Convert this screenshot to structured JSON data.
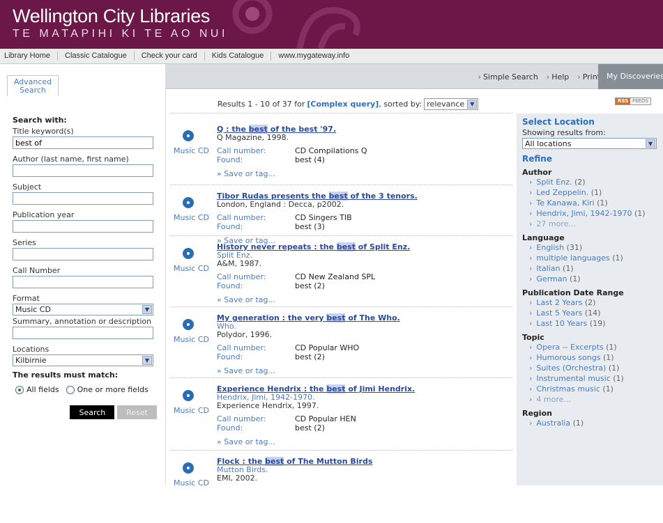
{
  "banner": {
    "title": "Wellington City Libraries",
    "subtitle": "TE MATAPIHI KI TE AO NUI"
  },
  "topnav": [
    "Library Home",
    "Classic Catalogue",
    "Check your card",
    "Kids Catalogue",
    "www.mygateway.info"
  ],
  "tabs": {
    "advanced_line1": "Advanced",
    "advanced_line2": "Search",
    "simple_search": "Simple Search",
    "help": "Help",
    "print": "Print",
    "my_discoveries": "My Discoveries"
  },
  "form": {
    "heading": "Search with:",
    "title_label": "Title keyword(s)",
    "title_value": "best of",
    "author_label": "Author (last name, first name)",
    "subject_label": "Subject",
    "year_label": "Publication year",
    "series_label": "Series",
    "call_label": "Call Number",
    "format_label": "Format",
    "format_value": "Music CD",
    "summary_label": "Summary, annotation or description",
    "locations_label": "Locations",
    "locations_value": "Kilbirnie",
    "must_match": "The results must match:",
    "radio_all": "All fields",
    "radio_one": "One or more fields",
    "search_button": "Search",
    "reset_button": "Reset"
  },
  "summary": {
    "prefix": "Results 1 - 10 of 37 for",
    "query": "[Complex query]",
    "sorted_by": ", sorted by:",
    "sort_value": "relevance"
  },
  "rss": {
    "a": "RSS",
    "b": "FEEDS"
  },
  "results": [
    {
      "pre": "Q : the ",
      "hl": "best",
      "post": " of the best '97.",
      "author": "",
      "lines": [
        "Q Magazine, 1998."
      ],
      "call": "CD Compilations Q",
      "found": "best (4)",
      "format": "Music CD"
    },
    {
      "pre": "Tibor Rudas presents the ",
      "hl": "best",
      "post": " of the 3 tenors.",
      "author": "",
      "lines": [
        "London, England : Decca, p2002."
      ],
      "call": "CD Singers TIB",
      "found": "best (3)",
      "format": "Music CD"
    },
    {
      "pre": "History never repeats : the ",
      "hl": "best",
      "post": " of Split Enz.",
      "author": "Split Enz.",
      "lines": [
        "A&M, 1987."
      ],
      "call": "CD New Zealand SPL",
      "found": "best (2)",
      "format": "Music CD"
    },
    {
      "pre": "My generation : the very ",
      "hl": "best",
      "post": " of The Who.",
      "author": "Who.",
      "lines": [
        "Polydor, 1996."
      ],
      "call": "CD Popular WHO",
      "found": "best (2)",
      "format": "Music CD"
    },
    {
      "pre": "Experience Hendrix : the ",
      "hl": "best",
      "post": " of Jimi Hendrix.",
      "author": "Hendrix, Jimi, 1942-1970.",
      "lines": [
        "Experience Hendrix, 1997."
      ],
      "call": "CD Popular HEN",
      "found": "best (2)",
      "format": "Music CD"
    },
    {
      "pre": "Flock : the ",
      "hl": "best",
      "post": " of The Mutton Birds",
      "author": "Mutton Birds.",
      "lines": [
        "EMI, 2002."
      ],
      "call": "",
      "found": "",
      "format": "Music CD"
    }
  ],
  "result_labels": {
    "call": "Call number:",
    "found": "Found:",
    "save": "» Save or tag..."
  },
  "rightpanel": {
    "select_location": "Select Location",
    "showing": "Showing results from:",
    "location_value": "All locations",
    "refine": "Refine",
    "facets": [
      {
        "name": "Author",
        "items": [
          {
            "label": "Split Enz.",
            "count": "(2)"
          },
          {
            "label": "Led Zeppelin.",
            "count": "(1)"
          },
          {
            "label": "Te Kanawa, Kiri",
            "count": "(1)"
          },
          {
            "label": "Hendrix, Jimi, 1942-1970",
            "count": "(1)"
          },
          {
            "label": "27 more...",
            "count": "",
            "more": true
          }
        ]
      },
      {
        "name": "Language",
        "items": [
          {
            "label": "English",
            "count": "(31)"
          },
          {
            "label": "multiple languages",
            "count": "(1)"
          },
          {
            "label": "Italian",
            "count": "(1)"
          },
          {
            "label": "German",
            "count": "(1)"
          }
        ]
      },
      {
        "name": "Publication Date Range",
        "items": [
          {
            "label": "Last 2 Years",
            "count": "(2)"
          },
          {
            "label": "Last 5 Years",
            "count": "(14)"
          },
          {
            "label": "Last 10 Years",
            "count": "(19)"
          }
        ]
      },
      {
        "name": "Topic",
        "items": [
          {
            "label": "Opera -- Excerpts",
            "count": "(1)"
          },
          {
            "label": "Humorous songs",
            "count": "(1)"
          },
          {
            "label": "Suites (Orchestra)",
            "count": "(1)"
          },
          {
            "label": "Instrumental music",
            "count": "(1)"
          },
          {
            "label": "Christmas music",
            "count": "(1)"
          },
          {
            "label": "4 more...",
            "count": "",
            "more": true
          }
        ]
      },
      {
        "name": "Region",
        "items": [
          {
            "label": "Australia",
            "count": "(1)"
          }
        ]
      }
    ]
  }
}
